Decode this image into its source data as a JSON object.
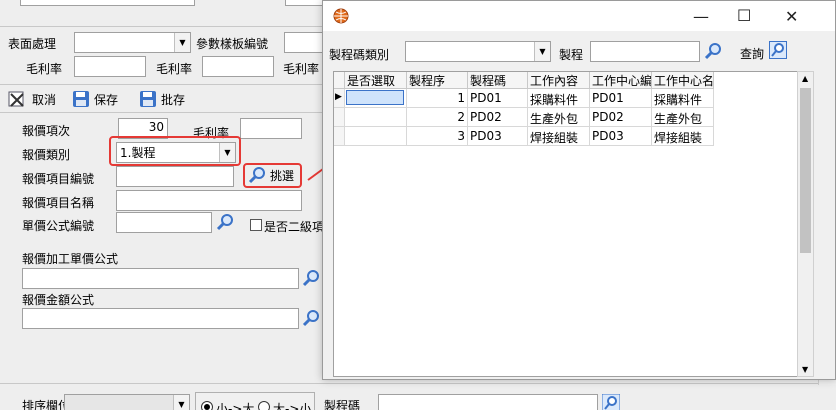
{
  "top_form": {
    "surface_label": "表面處理",
    "ref_template_label": "參數樣板編號",
    "margin_label_1": "毛利率",
    "margin_label_2": "毛利率",
    "margin_label_3": "毛利率"
  },
  "toolbar": {
    "cancel_label": "取消",
    "save_label": "保存",
    "batch_save_label": "批存"
  },
  "quote_form": {
    "item_no_label": "報價項次",
    "item_no_value": "30",
    "margin_label": "毛利率",
    "type_label": "報價類別",
    "type_value": "1.製程",
    "item_code_label": "報價項目編號",
    "pick_label": "挑選",
    "item_name_label": "報價項目名稱",
    "unit_formula_label": "單價公式編號",
    "second_level_label": "是否二級項",
    "process_unit_formula_label": "報價加工單價公式",
    "amount_formula_label": "報價金額公式"
  },
  "bottom_bar": {
    "sort_label": "排序欄位",
    "radio_asc": "小->大",
    "radio_desc": "大->小",
    "code_label": "製程碼"
  },
  "popup": {
    "category_label": "製程碼類別",
    "process_label": "製程",
    "query_label": "查詢",
    "columns": [
      "是否選取",
      "製程序",
      "製程碼",
      "工作內容",
      "工作中心編",
      "工作中心名"
    ],
    "rows": [
      {
        "seq": "1",
        "code": "PD01",
        "content": "採購料件",
        "center_no": "PD01",
        "center_name": "採購料件"
      },
      {
        "seq": "2",
        "code": "PD02",
        "content": "生產外包",
        "center_no": "PD02",
        "center_name": "生產外包"
      },
      {
        "seq": "3",
        "code": "PD03",
        "content": "焊接組裝",
        "center_no": "PD03",
        "center_name": "焊接組裝"
      }
    ]
  },
  "colors": {
    "highlight": "#e53935",
    "accent": "#3b73c8"
  }
}
